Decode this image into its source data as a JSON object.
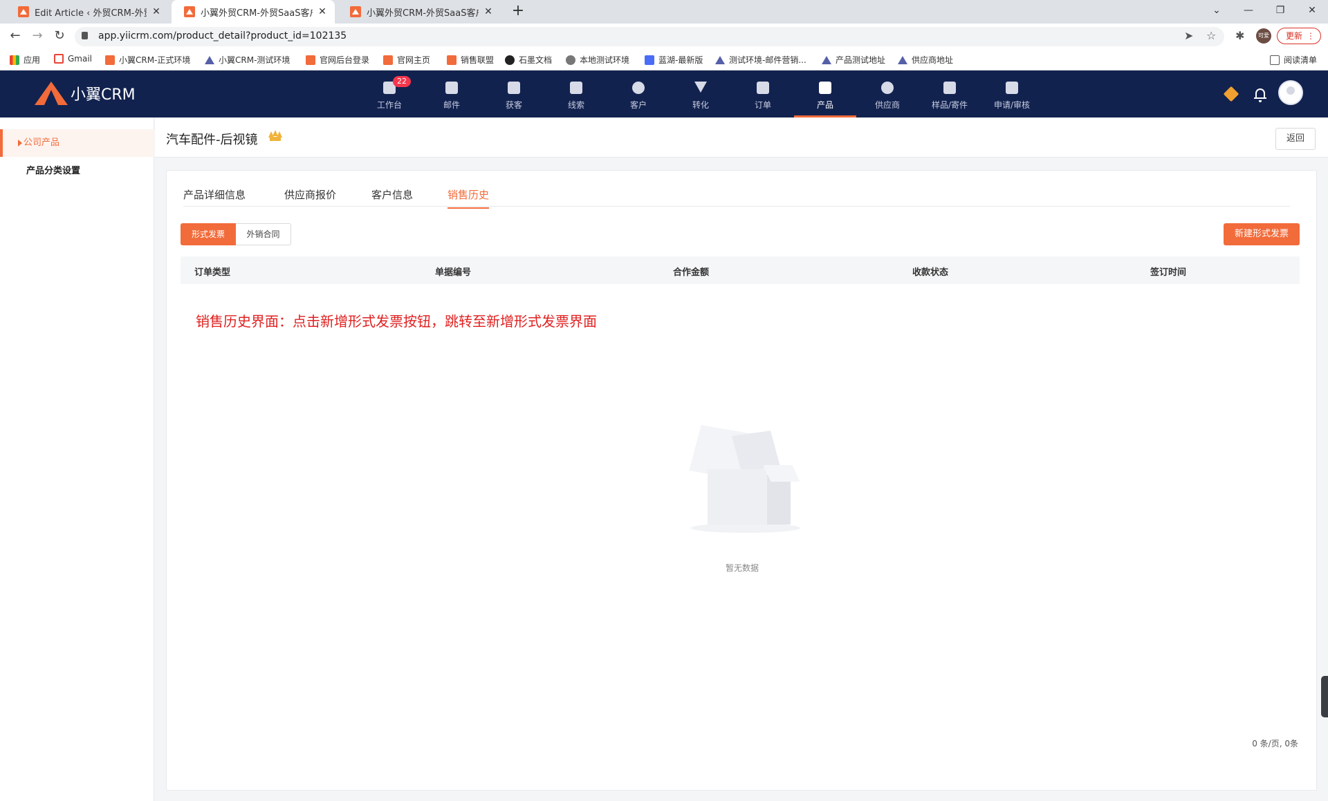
{
  "browser": {
    "tabs": [
      {
        "title": "Edit Article ‹ 外贸CRM-外贸管理",
        "active": false
      },
      {
        "title": "小翼外贸CRM-外贸SaaS客户管理",
        "active": true
      },
      {
        "title": "小翼外贸CRM-外贸SaaS客户管理",
        "active": false
      }
    ],
    "new_tab": "+",
    "url": "app.yiicrm.com/product_detail?product_id=102135",
    "profile_label": "可爱",
    "update_label": "更新",
    "bookmarks": [
      {
        "label": "应用",
        "icon": "apps-icon"
      },
      {
        "label": "Gmail",
        "icon": "gmail-icon"
      },
      {
        "label": "小翼CRM-正式环境",
        "icon": "xiaoyi-icon"
      },
      {
        "label": "小翼CRM-测试环境",
        "icon": "triangle-icon"
      },
      {
        "label": "官网后台登录",
        "icon": "xiaoyi-icon"
      },
      {
        "label": "官网主页",
        "icon": "xiaoyi-icon"
      },
      {
        "label": "销售联盟",
        "icon": "xiaoyi-icon"
      },
      {
        "label": "石墨文档",
        "icon": "shimo-icon"
      },
      {
        "label": "本地测试环境",
        "icon": "globe-icon"
      },
      {
        "label": "蓝湖-最新版",
        "icon": "lanhu-icon"
      },
      {
        "label": "测试环境-邮件营销...",
        "icon": "triangle-icon"
      },
      {
        "label": "产品测试地址",
        "icon": "triangle-icon"
      },
      {
        "label": "供应商地址",
        "icon": "triangle-icon"
      }
    ],
    "reading_list": "阅读清单"
  },
  "app": {
    "logo_text": "小翼CRM",
    "nav": [
      {
        "label": "工作台",
        "icon": "workbench-icon",
        "badge": "22"
      },
      {
        "label": "邮件",
        "icon": "mail-icon"
      },
      {
        "label": "获客",
        "icon": "acquire-icon"
      },
      {
        "label": "线索",
        "icon": "leads-icon"
      },
      {
        "label": "客户",
        "icon": "customer-icon"
      },
      {
        "label": "转化",
        "icon": "funnel-icon"
      },
      {
        "label": "订单",
        "icon": "order-icon"
      },
      {
        "label": "产品",
        "icon": "product-icon",
        "active": true
      },
      {
        "label": "供应商",
        "icon": "supplier-icon"
      },
      {
        "label": "样品/寄件",
        "icon": "sample-icon"
      },
      {
        "label": "申请/审核",
        "icon": "approval-icon"
      }
    ]
  },
  "sidebar": {
    "items": [
      {
        "label": "公司产品",
        "active": true
      },
      {
        "label": "产品分类设置",
        "active": false
      }
    ]
  },
  "page": {
    "title": "汽车配件-后视镜",
    "back_label": "返回",
    "tabs": [
      {
        "label": "产品详细信息"
      },
      {
        "label": "供应商报价"
      },
      {
        "label": "客户信息"
      },
      {
        "label": "销售历史",
        "active": true
      }
    ],
    "segments": [
      {
        "label": "形式发票",
        "active": true
      },
      {
        "label": "外销合同",
        "active": false
      }
    ],
    "new_button": "新建形式发票",
    "table": {
      "columns": [
        "订单类型",
        "单据编号",
        "合作金额",
        "收款状态",
        "签订时间"
      ],
      "rows": []
    },
    "annotation": "销售历史界面：点击新增形式发票按钮，跳转至新增形式发票界面",
    "empty_text": "暂无数据",
    "pagination": "0 条/页,  0条"
  },
  "colors": {
    "accent": "#f26b3a",
    "header_bg": "#12224f",
    "annotation": "#e02020"
  }
}
